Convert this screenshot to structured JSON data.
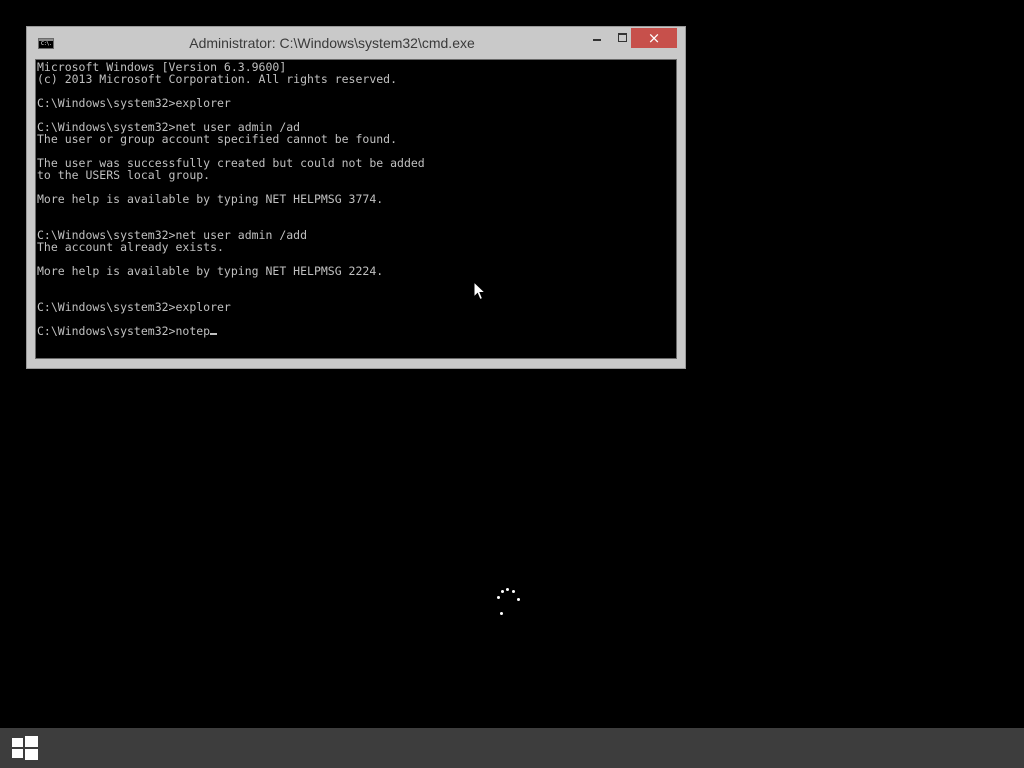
{
  "window": {
    "title": "Administrator: C:\\Windows\\system32\\cmd.exe",
    "icon_label": "C:\\.",
    "close_label": "×",
    "close_color": "#c7504b"
  },
  "console": {
    "lines": [
      "Microsoft Windows [Version 6.3.9600]",
      "(c) 2013 Microsoft Corporation. All rights reserved.",
      "",
      "C:\\Windows\\system32>explorer",
      "",
      "C:\\Windows\\system32>net user admin /ad",
      "The user or group account specified cannot be found.",
      "",
      "The user was successfully created but could not be added",
      "to the USERS local group.",
      "",
      "More help is available by typing NET HELPMSG 3774.",
      "",
      "",
      "C:\\Windows\\system32>net user admin /add",
      "The account already exists.",
      "",
      "More help is available by typing NET HELPMSG 2224.",
      "",
      "",
      "C:\\Windows\\system32>explorer",
      "",
      "C:\\Windows\\system32>notep"
    ],
    "text_color": "#c0c0c0",
    "background": "#000000"
  },
  "icons": {
    "cmd": "cmd-icon",
    "minimize": "minimize-icon",
    "maximize": "maximize-icon",
    "close": "close-icon",
    "pointer": "mouse-pointer-icon",
    "spinner": "loading-spinner-icon",
    "start": "windows-logo-icon"
  },
  "taskbar": {
    "background": "#3d3d3d"
  }
}
